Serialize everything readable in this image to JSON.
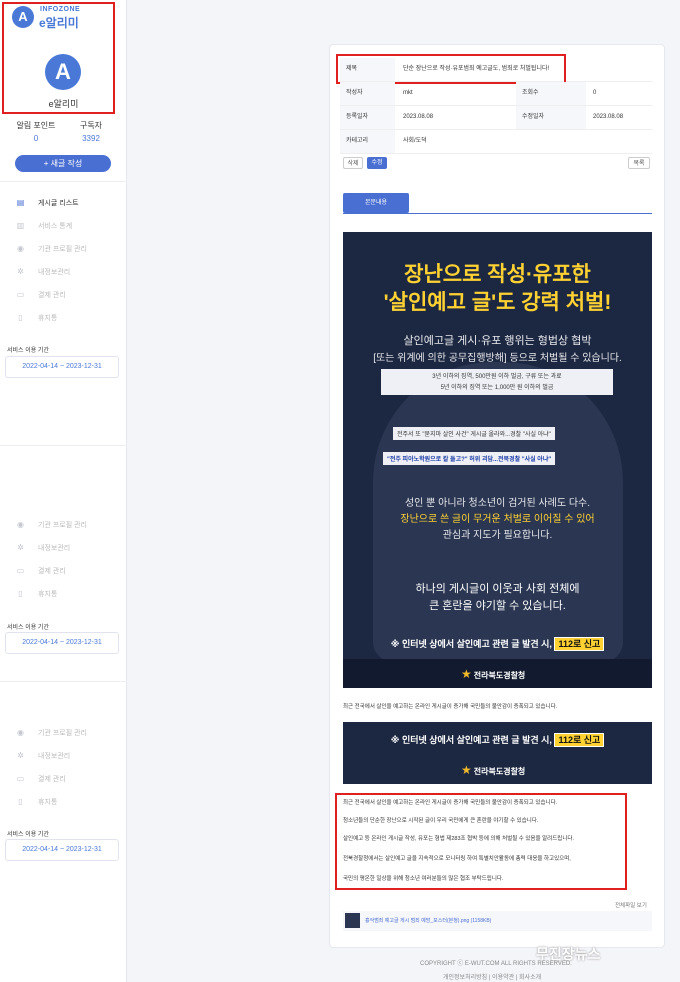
{
  "sidebar": {
    "logo_small": "A",
    "logo_sub": "INFOZONE",
    "logo_name": "e알리미",
    "avatar_letter": "A",
    "user_name": "e알리미",
    "stats": [
      {
        "label": "알림 포인트",
        "value": "0"
      },
      {
        "label": "구독자",
        "value": "3392"
      }
    ],
    "new_button": "+ 새글 작성",
    "nav": [
      {
        "icon": "▤",
        "label": "게시글 리스트"
      },
      {
        "icon": "▥",
        "label": "서비스 통계"
      },
      {
        "icon": "◉",
        "label": "기관 프로필 관리"
      },
      {
        "icon": "✲",
        "label": "내정보관리"
      },
      {
        "icon": "▭",
        "label": "결제 관리"
      },
      {
        "icon": "▯",
        "label": "휴지통"
      }
    ],
    "service_label": "서비스 이용 기간",
    "service_period": "2022-04-14 ~ 2023-12-31",
    "nav_repeat": [
      {
        "icon": "◉",
        "label": "기관 프로필 관리"
      },
      {
        "icon": "✲",
        "label": "내정보관리"
      },
      {
        "icon": "▭",
        "label": "결제 관리"
      },
      {
        "icon": "▯",
        "label": "휴지통"
      }
    ]
  },
  "post": {
    "title_label": "제목",
    "title": "단순 장난으로 작성·유포범죄 예고글도, 범죄로 처벌됩니다!",
    "author_label": "작성자",
    "author": "mkt",
    "views_label": "조회수",
    "views": "0",
    "reg_label": "등록일자",
    "reg_date": "2023.08.08",
    "mod_label": "수정일자",
    "mod_date": "2023.08.08",
    "category_label": "카테고리",
    "category": "사회/도덕",
    "delete_btn": "삭제",
    "edit_btn": "수정",
    "list_btn": "목록",
    "tab_label": "본문내용"
  },
  "poster": {
    "head1": "장난으로 작성·유포한",
    "head2": "'살인예고 글'도 강력 처벌!",
    "line1": "살인예고글 게시·유포 행위는 협박 및 협박상",
    "line1_shown": "살인예고글 게시·유포 행위는 형법상 협박",
    "line2": "[또는 위계에 의한 공무집행방해] 등으로 처벌될 수 있습니다.",
    "penalty1": "3년 이하의 징역, 500만원 이하 벌금, 구류 또는 과료",
    "penalty2": "5년 이하의 징역 또는 1,000만 원 이하의 벌금",
    "news1": "전주서 또 \"묻지마 살인 사건\" 게시글 올라와...경찰 \"사실 아냐\"",
    "news2": "\"전주 피아노학원으로 칼 들고?\" 허위 괴담...전북경찰 \"사실 아냐\"",
    "mid1": "성인 뿐 아니라 청소년이 검거된 사례도 다수.",
    "mid2": "장난으로 쓴 글이 무거운 처벌로 이어질 수 있어",
    "mid3": "관심과 지도가 필요합니다.",
    "quote1": "하나의 게시글이 이웃과 사회 전체에",
    "quote2": "큰 혼란을 야기할 수 있습니다.",
    "report_pre": "※ 인터넷 상에서 살인예고 관련 글 발견 시,",
    "report_tag": "112로 신고",
    "police": "전라북도경찰청",
    "police_en": "JEONBUK PROVINCIAL POLICE"
  },
  "body": {
    "intro": "최근 전국에서 살인을 예고하는 온라인 게시글이 증가해 국민들의 불안감이 증폭되고 있습니다.",
    "p1": "최근 전국에서 살인을 예고하는 온라인 게시글이 증가해 국민들의 불안감이 증폭되고 있습니다.",
    "p2": "청소년들의 단순한 장난으로 시작된 글이 우리 국민에게 큰 혼란을 야기할 수 있습니다.",
    "p3": "살인예고 등 온라인 게시글 작성, 유포는 형법 제283조 협박 등에 의해 처벌될 수 있음을 알려드립니다.",
    "p4": "전북경찰청에서는 살인예고 글을 지속적으로 모니터링 하여 특별치안활동에 총력 대응을 하고있으며,",
    "p5": "국민의 평온한 일상을 위해 청소년 여러분들의 많은 협조 부탁드립니다.",
    "attach_toggle": "전체파일 보기",
    "attach_name": "흉악범죄 예고글 게시 범죄 예방_포스터(본청).png (1158KB)"
  },
  "footer": {
    "copyright": "COPYRIGHT ⓒ E-WUT.COM ALL RIGHTS RESERVED.",
    "links": "개인정보처리방침 | 이용약관 | 회사소개",
    "watermark": "무진장뉴스"
  }
}
